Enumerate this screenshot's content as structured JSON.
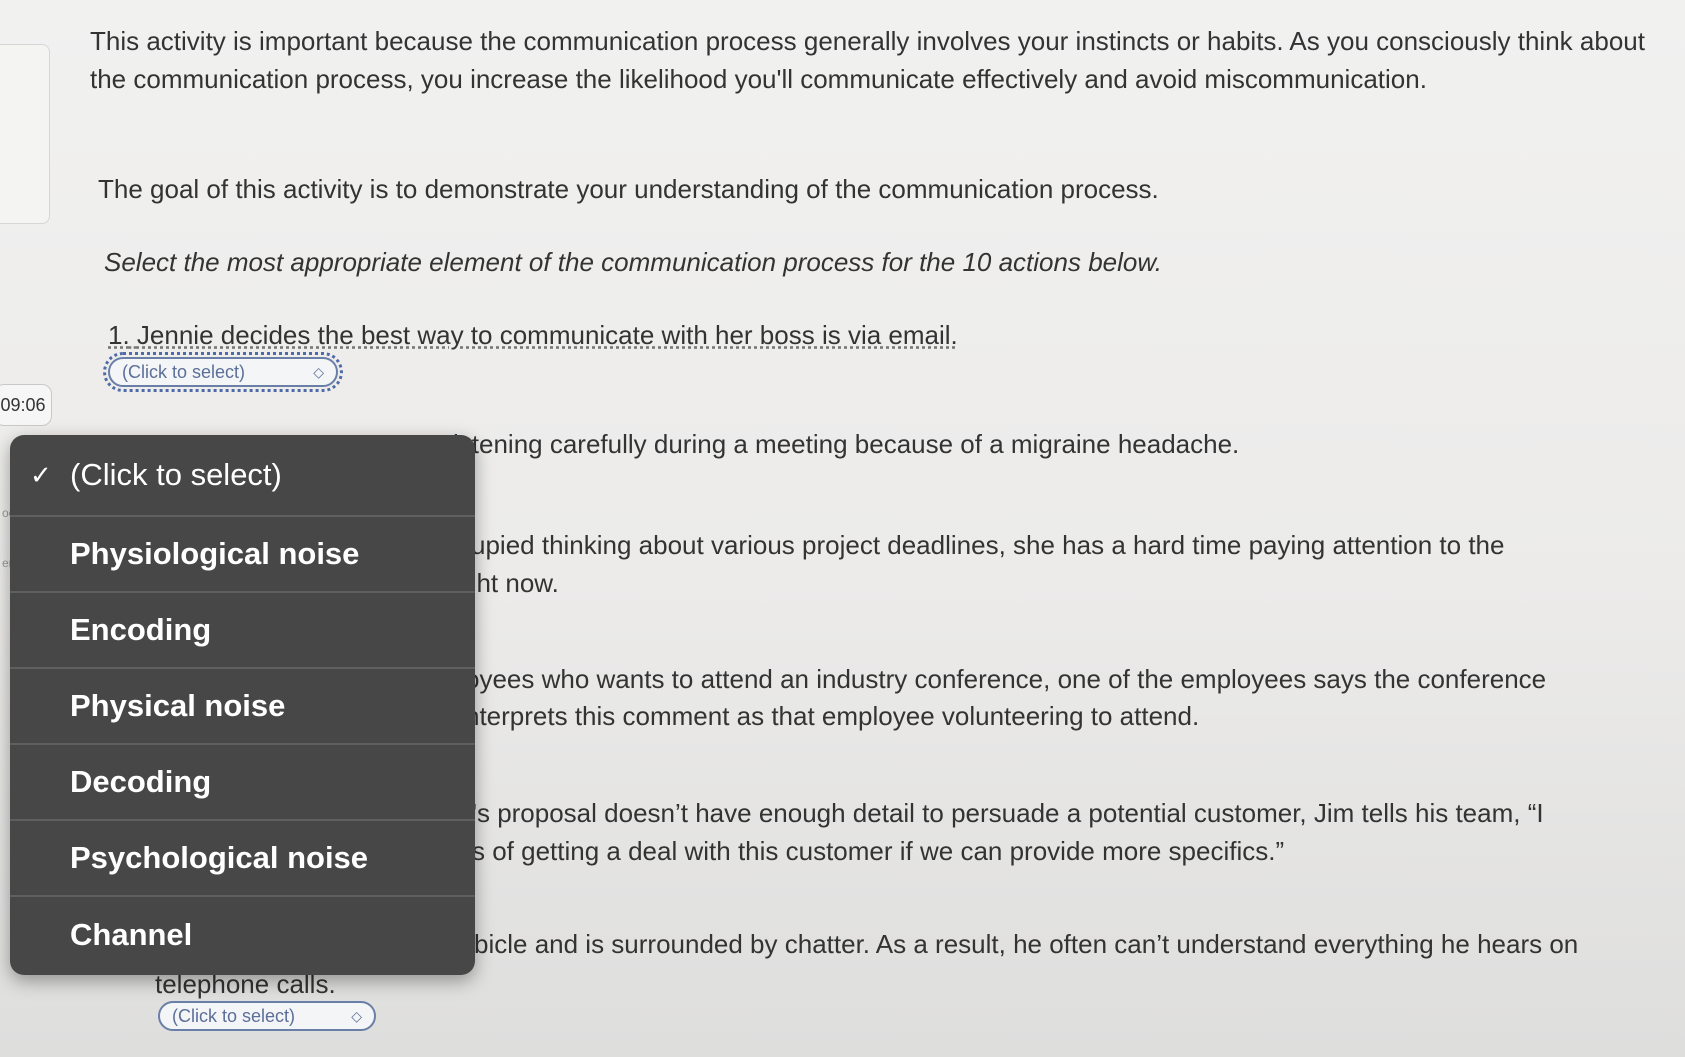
{
  "timer": "09:06",
  "intro": {
    "importance": "This activity is important because the communication process generally involves your instincts or habits. As you consciously think about the communication process, you increase the likelihood you'll communicate effectively and avoid miscommunication.",
    "goal": "The goal of this activity is to demonstrate your understanding of the communication process.",
    "instruction": "Select the most appropriate element of the communication process for the 10 actions below."
  },
  "questions": {
    "q1_number": "1.",
    "q1_text": "Jennie decides the best way to communicate with her boss is via email.",
    "q2_fragment": "istening carefully during a meeting because of a migraine headache.",
    "q3_fragment_a": "cupied thinking about various project deadlines, she has a hard time paying attention to the",
    "q3_fragment_b": "ght now.",
    "q4_fragment_a": "oyees who wants to attend an industry conference, one of the employees says the conference",
    "q4_fragment_b": "nterprets this comment as that employee volunteering to attend.",
    "q5_fragment_a": "'s proposal doesn’t have enough detail to persuade a potential customer, Jim tells his team, “I",
    "q5_fragment_b": "s of getting a deal with this customer if we can provide more specifics.”",
    "q6_fragment_a": "bicle and is surrounded by chatter. As a result, he often can’t understand everything he hears on",
    "q6_fragment_b": "telephone calls."
  },
  "select": {
    "placeholder": "(Click to select)",
    "icon": "up-down-chevron"
  },
  "dropdown": {
    "options": [
      "(Click to select)",
      "Physiological noise",
      "Encoding",
      "Physical noise",
      "Decoding",
      "Psychological noise",
      "Channel"
    ],
    "selected": "(Click to select)"
  },
  "edge_fragments": {
    "a": "oc",
    "b": "er"
  }
}
